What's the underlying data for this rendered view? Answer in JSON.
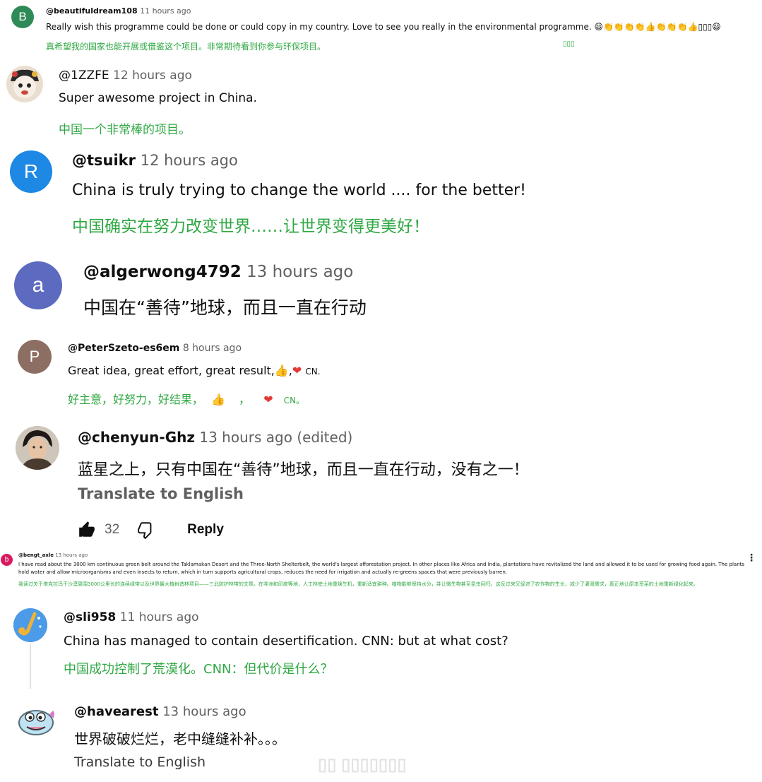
{
  "comments": [
    {
      "handle": "@beautifuldream108",
      "time": "11 hours ago",
      "avatar_letter": "B",
      "avatar_color": "#2e8b57",
      "text": "Really wish this programme could be done or could copy in my country. Love to see you really in the environmental programme.",
      "text_emojis": "😄👏👏👏👏👍👏👏👏👍▯▯▯😄",
      "translation": "真希望我的国家也能开展或借鉴这个项目。非常期待看到你参与环保项目。",
      "translation_tail": "▯▯▯"
    },
    {
      "handle": "@1ZZFE",
      "time": "12 hours ago",
      "avatar_icon": "cartoon-character-avatar",
      "text": "Super awesome project in China.",
      "translation": "中国一个非常棒的项目。"
    },
    {
      "handle": "@tsuikr",
      "time": "12 hours ago",
      "avatar_letter": "R",
      "avatar_color": "#1e88e5",
      "text": "China is truly trying to change the world .... for the better!",
      "translation": "中国确实在努力改变世界……让世界变得更美好！"
    },
    {
      "handle": "@algerwong4792",
      "time": "13 hours ago",
      "avatar_letter": "a",
      "avatar_color": "#5c6bc0",
      "text": "中国在“善待”地球，而且一直在行动"
    },
    {
      "handle": "@PeterSzeto-es6em",
      "time": "8 hours ago",
      "avatar_letter": "P",
      "avatar_color": "#8d6e63",
      "text": "Great idea, great effort, great result,",
      "text_tail": "CN.",
      "translation": "好主意，好努力，好结果，",
      "translation_tail": "CN。"
    },
    {
      "handle": "@chenyun-Ghz",
      "time": "13 hours ago (edited)",
      "avatar_icon": "person-photo-avatar",
      "text": "蓝星之上，只有中国在“善待”地球，而且一直在行动，没有之一！",
      "translate_link": "Translate to English",
      "likes": "32",
      "reply_label": "Reply"
    },
    {
      "handle": "@bengt_axle",
      "time": "13 hours ago",
      "avatar_letter": "b",
      "avatar_color": "#d81b60",
      "text": "I have read about the 3000 km continuous green belt around the Taklamakan Desert and the Three-North Shelterbelt, the world's largest afforestation project.  In other places like Africa and India, plantations have revitalized the land and allowed it to be used for growing food again. The plants hold water and allow microorganisms and  even insects to return, which in turn supports agricultural crops, reduces the need for irrigation and actually re-greens spaces that were previously barren.",
      "translation": "我读过关于塔克拉玛干沙漠周围3000公里长的连续绿带以及世界最大植树造林项目——三北防护林带的文章。在非洲和印度等地，人工林使土地重焕生机，重新适宜耕种。植物能够保持水分，并让微生物甚至昆虫回归，这反过来又促进了农作物的生长，减少了灌溉需求，真正地让原本荒芜的土地重新绿化起来。"
    },
    {
      "handle": "@sli958",
      "time": "11 hours ago",
      "avatar_icon": "saxophone-avatar",
      "text": "China has managed to contain desertification. CNN: but at what cost?",
      "translation": "中国成功控制了荒漠化。CNN：但代价是什么？"
    },
    {
      "handle": "@havearest",
      "time": "13 hours ago",
      "avatar_icon": "cartoon-fish-avatar",
      "text": "世界破破烂烂，老中缝缝补补。。。",
      "translate_link": "Translate to English"
    }
  ],
  "watermark": "▯▯ ▯▯▯▯▯▯▯",
  "colors": {
    "translation_green": "#2fa843",
    "meta_grey": "#606060"
  }
}
